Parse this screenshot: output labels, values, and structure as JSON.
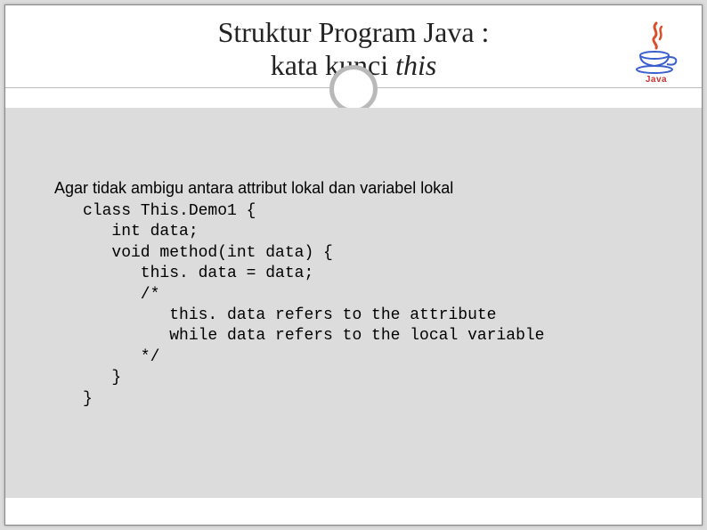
{
  "title": {
    "line1": "Struktur Program Java :",
    "line2_prefix": "kata kunci ",
    "line2_italic": "this"
  },
  "logo": {
    "name": "java-logo",
    "text": "Java"
  },
  "intro": "Agar tidak ambigu antara attribut lokal dan variabel lokal",
  "code": "class This.Demo1 {\n   int data;\n   void method(int data) {\n      this. data = data;\n      /*\n         this. data refers to the attribute\n         while data refers to the local variable\n      */\n   }\n}"
}
